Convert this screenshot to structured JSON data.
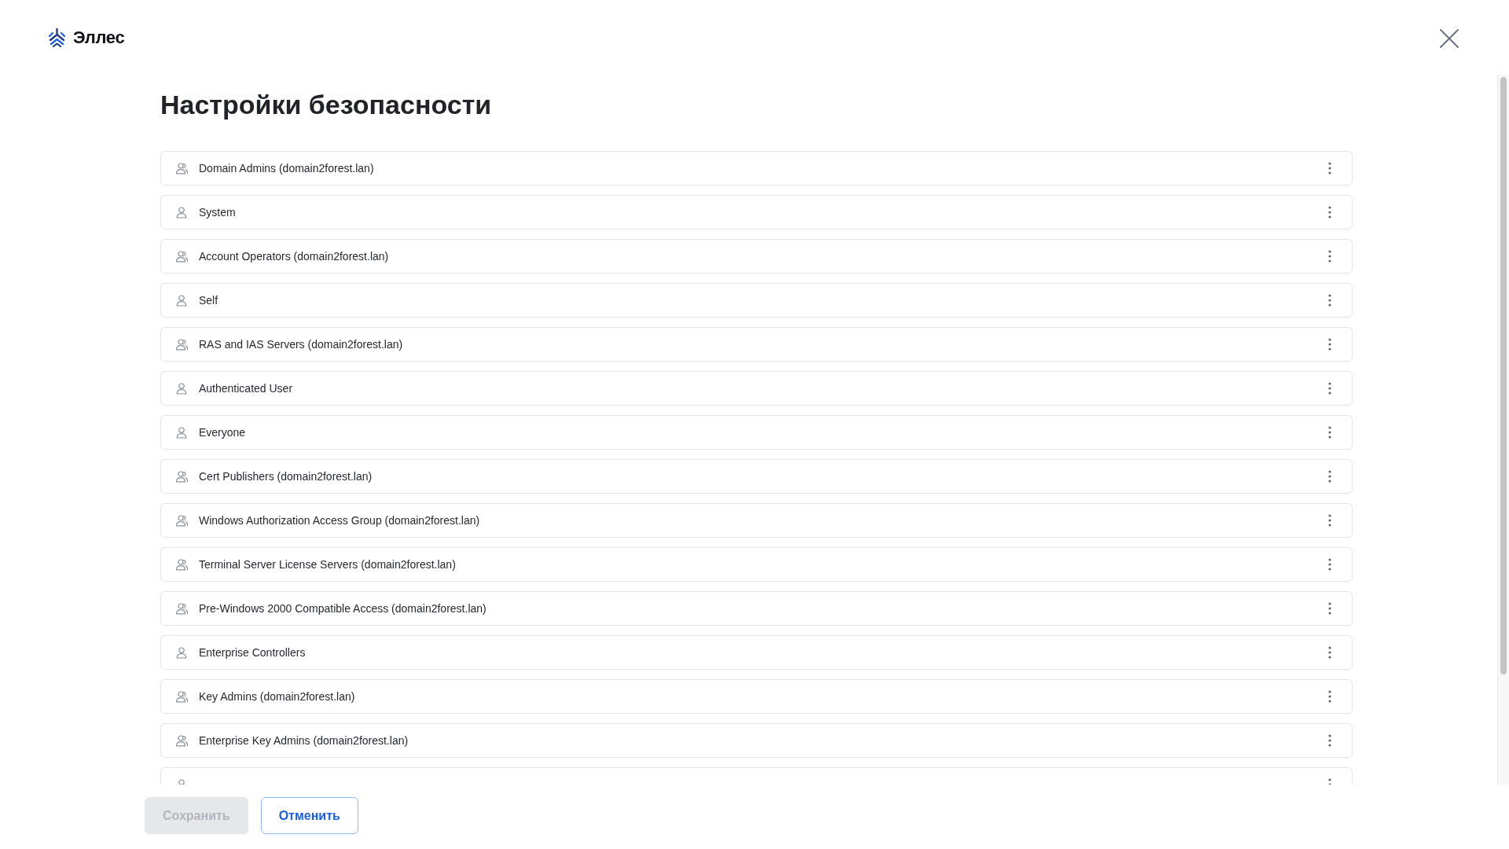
{
  "header": {
    "logo_text": "Эллес"
  },
  "title": "Настройки безопасности",
  "principals": [
    {
      "kind": "group",
      "name": "Domain Admins (domain2forest.lan)"
    },
    {
      "kind": "user",
      "name": "System"
    },
    {
      "kind": "group",
      "name": "Account Operators (domain2forest.lan)"
    },
    {
      "kind": "user",
      "name": "Self"
    },
    {
      "kind": "group",
      "name": "RAS and IAS Servers (domain2forest.lan)"
    },
    {
      "kind": "user",
      "name": "Authenticated User"
    },
    {
      "kind": "user",
      "name": "Everyone"
    },
    {
      "kind": "group",
      "name": "Cert Publishers (domain2forest.lan)"
    },
    {
      "kind": "group",
      "name": "Windows Authorization Access Group (domain2forest.lan)"
    },
    {
      "kind": "group",
      "name": "Terminal Server License Servers (domain2forest.lan)"
    },
    {
      "kind": "group",
      "name": "Pre-Windows 2000 Compatible Access (domain2forest.lan)"
    },
    {
      "kind": "user",
      "name": "Enterprise Controllers"
    },
    {
      "kind": "group",
      "name": "Key Admins (domain2forest.lan)"
    },
    {
      "kind": "group",
      "name": "Enterprise Key Admins (domain2forest.lan)"
    },
    {
      "kind": "user"
    }
  ],
  "buttons": [
    {
      "label": "Сохранить",
      "kind": "primary",
      "disabled": true
    },
    {
      "label": "Отменить",
      "kind": "secondary",
      "disabled": false
    }
  ]
}
